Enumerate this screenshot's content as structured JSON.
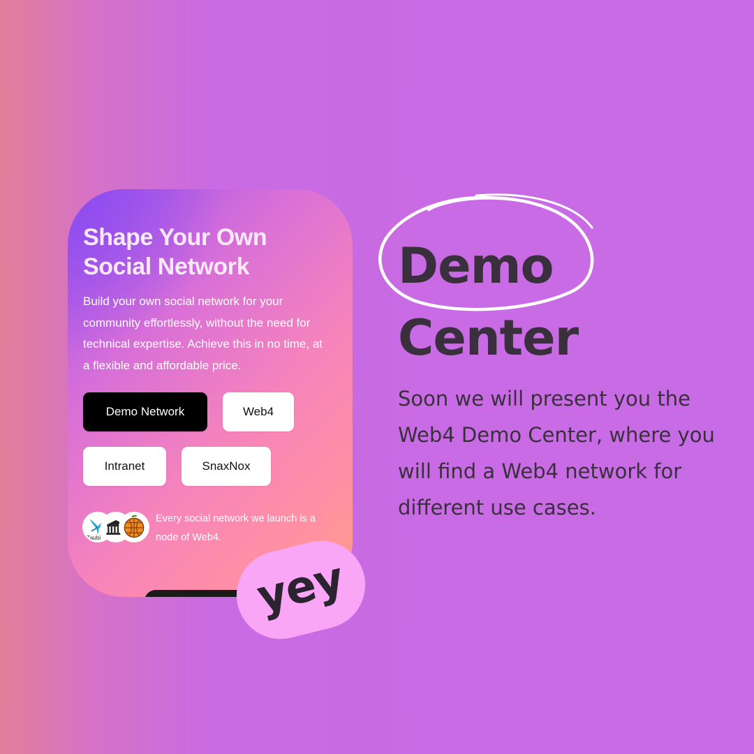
{
  "card": {
    "title_line1": "Shape Your Own",
    "title_line2": "Social Network",
    "description": "Build your own social network for your community effortlessly, without the need for technical expertise. Achieve this in no time, at a flexible and affordable price.",
    "buttons": [
      {
        "label": "Demo Network",
        "style": "primary"
      },
      {
        "label": "Web4",
        "style": "secondary"
      },
      {
        "label": "Intranet",
        "style": "secondary"
      },
      {
        "label": "SnaxNox",
        "style": "secondary"
      }
    ],
    "logos": [
      "zaubi-logo",
      "building-logo",
      "orange-globe-logo"
    ],
    "logo_text": "Zaubi",
    "network_note": "Every social network we launch is a node of Web4."
  },
  "sticker": {
    "label": "yey"
  },
  "heading": {
    "line1": "Demo",
    "line2": "Center"
  },
  "body": "Soon we will present you the Web4 Demo Center, where you will find a Web4 network for different use cases.",
  "colors": {
    "background": "#c76be6",
    "heading_text": "#3a2f3d",
    "sticker": "#f8a6f5",
    "primary_button": "#000000"
  }
}
